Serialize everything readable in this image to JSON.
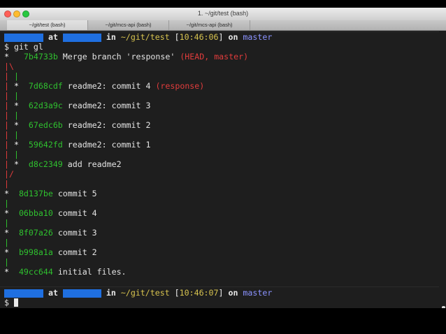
{
  "window": {
    "title": "1. ~/git/test (bash)",
    "tabs": [
      {
        "label": "~/git/test (bash)",
        "active": true
      },
      {
        "label": "~/git/mcs-api (bash)",
        "active": false
      },
      {
        "label": "~/git/mcs-api (bash)",
        "active": false
      }
    ]
  },
  "prompt1": {
    "at": "at",
    "in": "in",
    "path": "~/git/test",
    "time": "10:46:06",
    "on": "on",
    "branch": "master"
  },
  "command": "$ git gl",
  "log": {
    "merge": {
      "hash": "7b4733b",
      "msg": "Merge branch 'response'",
      "refs": "(HEAD, master)"
    },
    "branch_commits": [
      {
        "hash": "7d68cdf",
        "msg": "readme2: commit 4",
        "refs": "(response)"
      },
      {
        "hash": "62d3a9c",
        "msg": "readme2: commit 3",
        "refs": ""
      },
      {
        "hash": "67edc6b",
        "msg": "readme2: commit 2",
        "refs": ""
      },
      {
        "hash": "59642fd",
        "msg": "readme2: commit 1",
        "refs": ""
      },
      {
        "hash": "d8c2349",
        "msg": "add readme2",
        "refs": ""
      }
    ],
    "main_commits": [
      {
        "hash": "8d137be",
        "msg": "commit 5"
      },
      {
        "hash": "06bba10",
        "msg": "commit 4"
      },
      {
        "hash": "8f07a26",
        "msg": "commit 3"
      },
      {
        "hash": "b998a1a",
        "msg": "commit 2"
      },
      {
        "hash": "49cc644",
        "msg": "initial files."
      }
    ]
  },
  "prompt2": {
    "at": "at",
    "in": "in",
    "path": "~/git/test",
    "time": "10:46:07",
    "on": "on",
    "branch": "master"
  },
  "final_prompt": "$",
  "graph": {
    "star": "*",
    "pipe": "|",
    "open": "|\\",
    "close": "|/"
  },
  "colors": {
    "hash": "#2fc12f",
    "refs": "#e03c3c",
    "time": "#d7c34f",
    "path": "#d7c34f",
    "branch": "#8b93ff",
    "redact": "#1f6fe0"
  }
}
